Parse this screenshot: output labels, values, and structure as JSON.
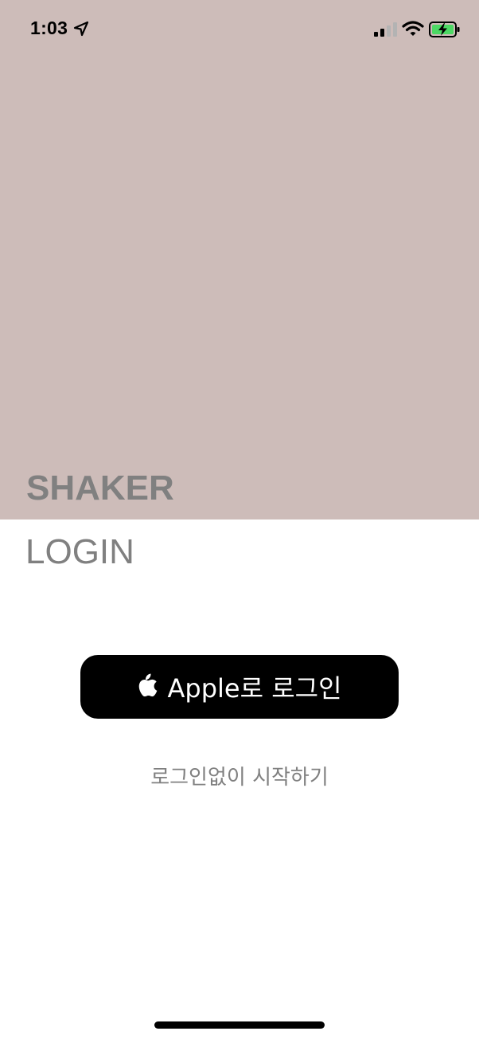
{
  "status_bar": {
    "time": "1:03",
    "icons": [
      "location-arrow-icon",
      "cellular-signal-icon",
      "wifi-icon",
      "battery-charging-icon"
    ]
  },
  "hero": {
    "background_color": "#cdbcb9",
    "brand_title": "SHAKER"
  },
  "login": {
    "heading": "LOGIN",
    "apple_button_label": "Apple로 로그인",
    "apple_button_icon": "apple-logo-icon",
    "skip_link_label": "로그인없이 시작하기"
  },
  "colors": {
    "text_gray": "#808080",
    "button_black": "#000000",
    "background_white": "#ffffff"
  }
}
